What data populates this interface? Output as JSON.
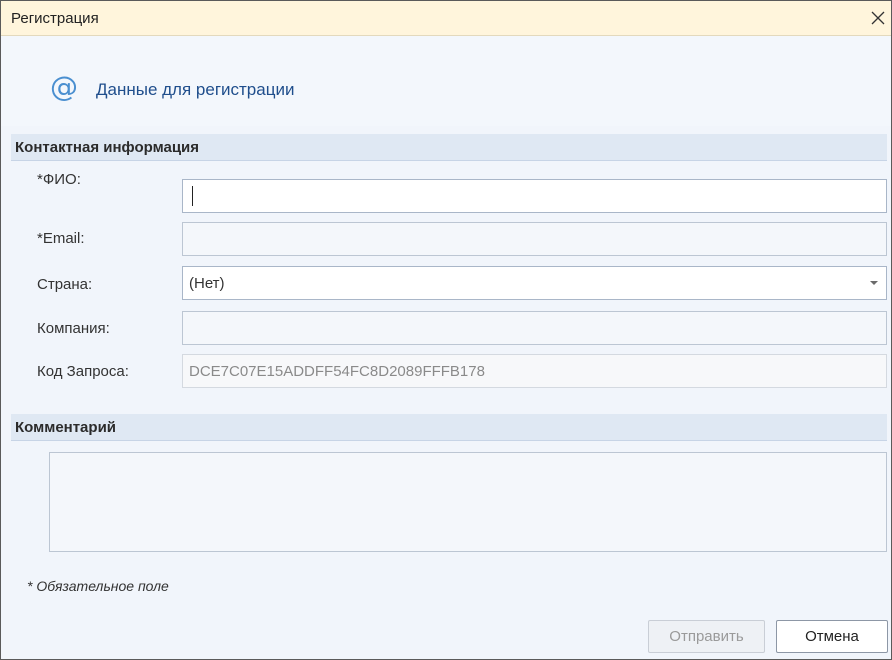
{
  "window": {
    "title": "Регистрация"
  },
  "header": {
    "icon": "at-sign-icon",
    "title": "Данные для регистрации"
  },
  "contact_section": {
    "title": "Контактная информация",
    "fields": [
      {
        "label": "*ФИО:",
        "value": ""
      },
      {
        "label": "*Email:",
        "value": ""
      },
      {
        "label": "Страна:",
        "value": "(Нет)"
      },
      {
        "label": "Компания:",
        "value": ""
      },
      {
        "label": "Код Запроса:",
        "value": "DCE7C07E15ADDFF54FC8D2089FFFB178"
      }
    ]
  },
  "comment_section": {
    "title": "Комментарий",
    "value": ""
  },
  "footer": {
    "required_note": "* Обязательное поле",
    "submit_label": "Отправить",
    "cancel_label": "Отмена"
  },
  "colors": {
    "titlebar_bg": "#fff5dc",
    "section_bar_bg": "#dfe8f3",
    "accent_blue": "#1f4e8c",
    "content_bg": "#f1f5fb"
  }
}
